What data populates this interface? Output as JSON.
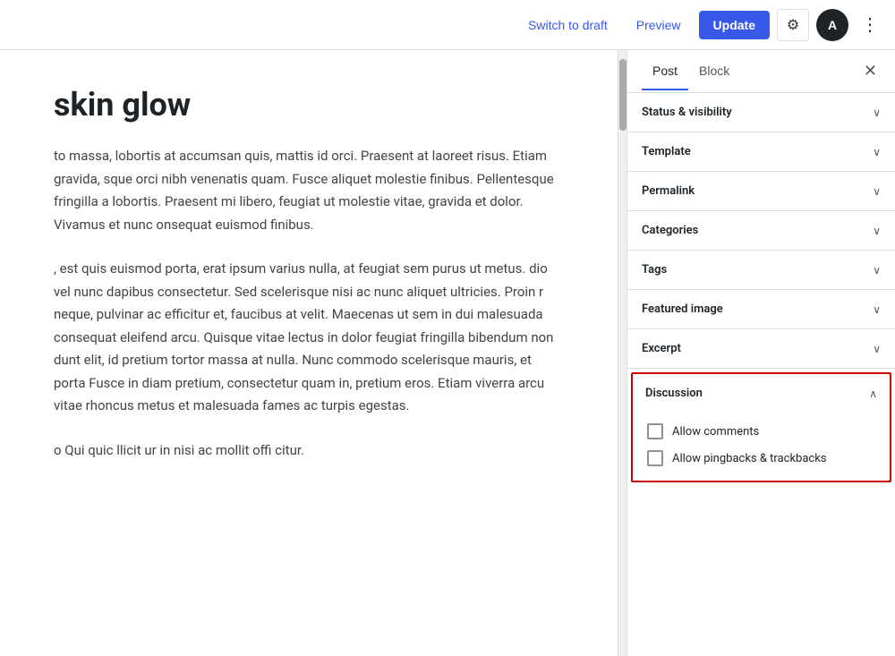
{
  "toolbar": {
    "switch_to_draft_label": "Switch to draft",
    "preview_label": "Preview",
    "update_label": "Update",
    "settings_icon": "⚙",
    "avatar_initials": "A",
    "more_icon": "⋮"
  },
  "sidebar": {
    "tab_post": "Post",
    "tab_block": "Block",
    "close_icon": "✕",
    "panels": [
      {
        "id": "status-visibility",
        "label": "Status & visibility",
        "chevron": "∨",
        "expanded": false
      },
      {
        "id": "template",
        "label": "Template",
        "chevron": "∨",
        "expanded": false
      },
      {
        "id": "permalink",
        "label": "Permalink",
        "chevron": "∨",
        "expanded": false
      },
      {
        "id": "categories",
        "label": "Categories",
        "chevron": "∨",
        "expanded": false
      },
      {
        "id": "tags",
        "label": "Tags",
        "chevron": "∨",
        "expanded": false
      },
      {
        "id": "featured-image",
        "label": "Featured image",
        "chevron": "∨",
        "expanded": false
      },
      {
        "id": "excerpt",
        "label": "Excerpt",
        "chevron": "∨",
        "expanded": false
      }
    ],
    "discussion": {
      "panel_label": "Discussion",
      "chevron_expanded": "∧",
      "allow_comments_label": "Allow comments",
      "allow_pingbacks_label": "Allow pingbacks & trackbacks",
      "allow_comments_checked": false,
      "allow_pingbacks_checked": false
    }
  },
  "editor": {
    "heading": "skin glow",
    "paragraph1": "to massa, lobortis at accumsan quis, mattis id orci. Praesent at laoreet risus. Etiam gravida, sque orci nibh venenatis quam. Fusce aliquet molestie finibus. Pellentesque fringilla a lobortis. Praesent mi libero, feugiat ut molestie vitae, gravida et dolor. Vivamus et nunc onsequat euismod finibus.",
    "paragraph2": ", est quis euismod porta, erat ipsum varius nulla, at feugiat sem purus ut metus. dio vel nunc dapibus consectetur. Sed scelerisque nisi ac nunc aliquet ultricies. Proin r neque, pulvinar ac efficitur et, faucibus at velit. Maecenas ut sem in dui malesuada consequat eleifend arcu. Quisque vitae lectus in dolor feugiat fringilla bibendum non dunt elit, id pretium tortor massa at nulla. Nunc commodo scelerisque mauris, et porta Fusce in diam pretium, consectetur quam in, pretium eros. Etiam viverra arcu vitae rhoncus metus et malesuada fames ac turpis egestas."
  }
}
